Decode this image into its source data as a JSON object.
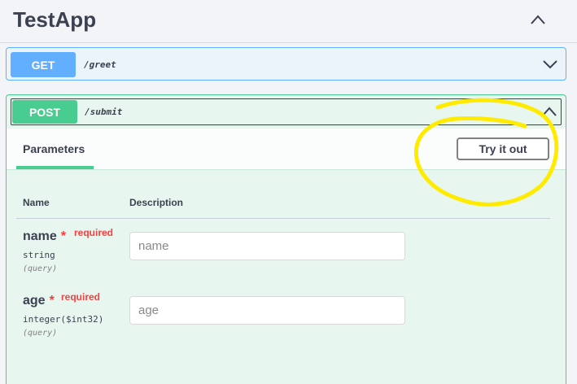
{
  "app": {
    "title": "TestApp"
  },
  "operations": [
    {
      "method": "GET",
      "path": "/greet"
    },
    {
      "method": "POST",
      "path": "/submit",
      "tab_label": "Parameters",
      "try_button": "Try it out",
      "columns": {
        "name": "Name",
        "description": "Description"
      },
      "params": [
        {
          "name": "name",
          "star": "*",
          "required": "required",
          "type": "string",
          "in": "(query)",
          "placeholder": "name"
        },
        {
          "name": "age",
          "star": "*",
          "required": "required",
          "type": "integer($int32)",
          "in": "(query)",
          "placeholder": "age"
        }
      ]
    }
  ],
  "icons": {
    "collapse": "chevron-up-icon",
    "expand": "chevron-down-icon"
  },
  "colors": {
    "get": "#61affe",
    "post": "#49cc90",
    "required": "#f93e3e",
    "annotation": "#ffeb00"
  }
}
